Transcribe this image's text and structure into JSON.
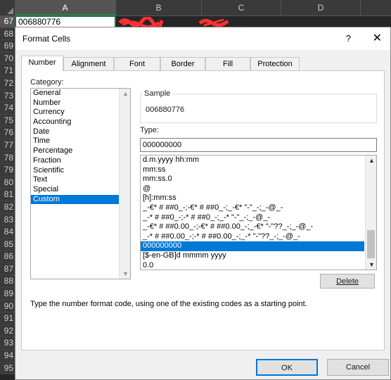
{
  "sheet": {
    "columns": [
      "A",
      "B",
      "C",
      "D"
    ],
    "rows": [
      "67",
      "68",
      "69",
      "70",
      "71",
      "72",
      "73",
      "74",
      "75",
      "76",
      "77",
      "78",
      "79",
      "80",
      "81",
      "82",
      "83",
      "84",
      "85",
      "86",
      "87",
      "88",
      "89",
      "90",
      "91",
      "92",
      "93",
      "94",
      "95"
    ],
    "cell_a67": "006880776"
  },
  "dialog": {
    "title": "Format Cells",
    "help": "?",
    "close": "✕",
    "tabs": [
      "Number",
      "Alignment",
      "Font",
      "Border",
      "Fill",
      "Protection"
    ],
    "active_tab": "Number",
    "category_label": "Category:",
    "categories": [
      "General",
      "Number",
      "Currency",
      "Accounting",
      "Date",
      "Time",
      "Percentage",
      "Fraction",
      "Scientific",
      "Text",
      "Special",
      "Custom"
    ],
    "selected_category": "Custom",
    "sample_label": "Sample",
    "sample_value": "006880776",
    "type_label": "Type:",
    "type_value": "000000000",
    "formats": [
      "d.m.yyyy hh:mm",
      "mm:ss",
      "mm:ss.0",
      "@",
      "[h]:mm:ss",
      "_-€* # ##0_-;-€* # ##0_-;_-€* \"-\"_-;_-@_-",
      "_-* # ##0_-;-* # ##0_-;_-* \"-\"_-;_-@_-",
      "_-€* # ##0.00_-;-€* # ##0.00_-;_-€* \"-\"??_-;_-@_-",
      "_-* # ##0.00_-;-* # ##0.00_-;_-* \"-\"??_-;_-@_-",
      "000000000",
      "[$-en-GB]d mmmm yyyy",
      "0.0"
    ],
    "selected_format": "000000000",
    "delete_label": "Delete",
    "hint": "Type the number format code, using one of the existing codes as a starting point.",
    "ok_label": "OK",
    "cancel_label": "Cancel"
  }
}
